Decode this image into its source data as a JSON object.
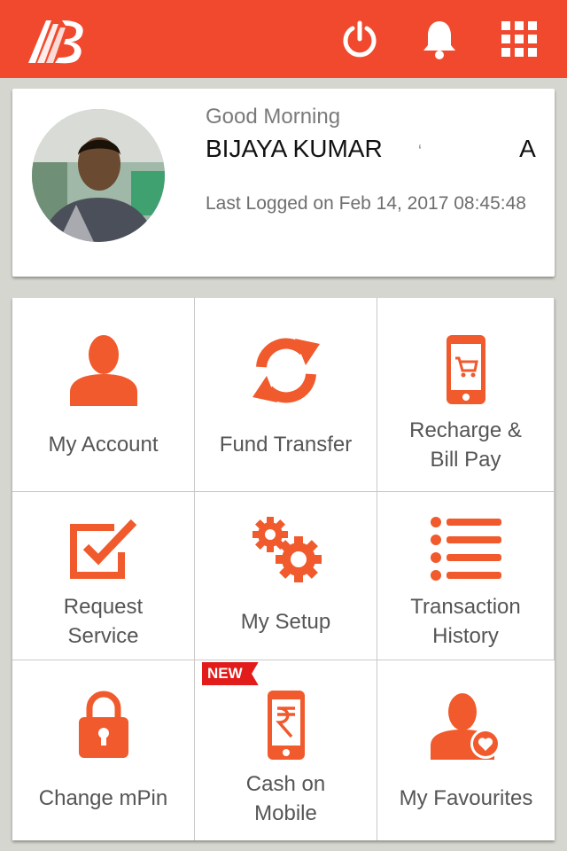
{
  "header": {
    "logo_icon": "bank-logo",
    "actions": [
      {
        "icon": "power-icon"
      },
      {
        "icon": "bell-icon"
      },
      {
        "icon": "apps-grid-icon"
      }
    ]
  },
  "profile": {
    "greeting": "Good Morning",
    "name": "BIJAYA KUMAR",
    "name_trailing_visible": "A",
    "last_logged": "Last Logged on Feb 14, 2017 08:45:48"
  },
  "menu": {
    "accent": "#f05a2c",
    "items": [
      {
        "label": "My Account",
        "icon": "person-icon"
      },
      {
        "label": "Fund Transfer",
        "icon": "refresh-arrows-icon"
      },
      {
        "label_line1": "Recharge &",
        "label_line2": "Bill Pay",
        "icon": "mobile-cart-icon"
      },
      {
        "label_line1": "Request",
        "label_line2": "Service",
        "icon": "checkbox-icon"
      },
      {
        "label": "My Setup",
        "icon": "gears-icon"
      },
      {
        "label_line1": "Transaction",
        "label_line2": "History",
        "icon": "list-icon"
      },
      {
        "label": "Change mPin",
        "icon": "lock-icon"
      },
      {
        "label_line1": "Cash on",
        "label_line2": "Mobile",
        "icon": "mobile-rupee-icon",
        "badge": "NEW"
      },
      {
        "label": "My Favourites",
        "icon": "person-heart-icon"
      }
    ]
  }
}
